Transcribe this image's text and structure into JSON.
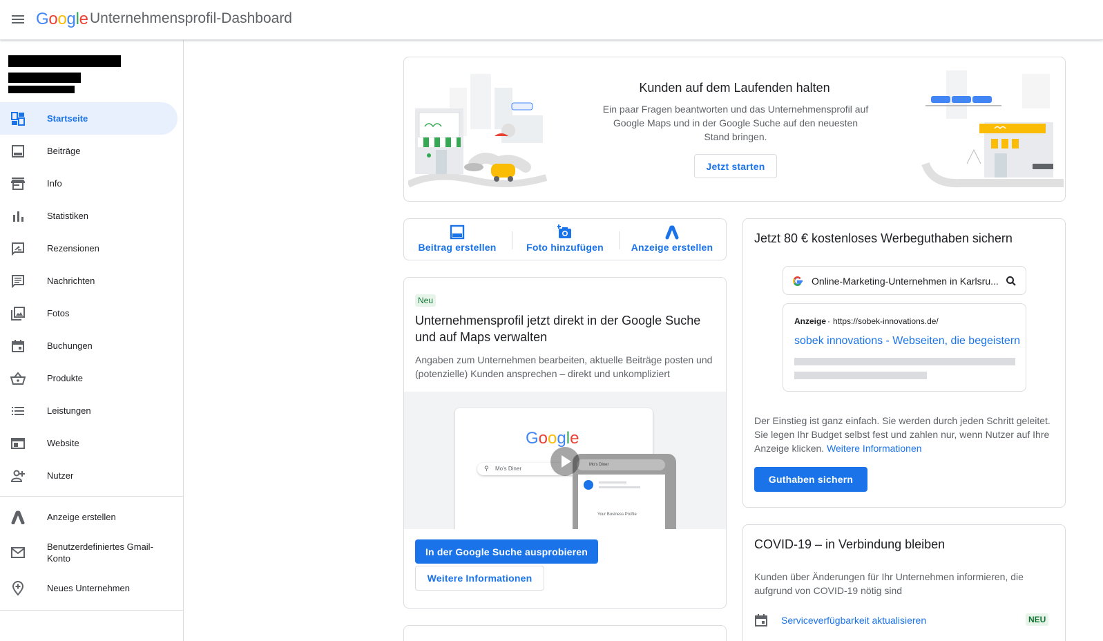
{
  "header": {
    "menu_icon": "menu-icon",
    "logo": "Google",
    "title": "Unternehmensprofil-Dashboard"
  },
  "sidebar": {
    "items": [
      {
        "label": "Startseite",
        "icon": "dashboard-icon"
      },
      {
        "label": "Beiträge",
        "icon": "posts-icon"
      },
      {
        "label": "Info",
        "icon": "storefront-icon"
      },
      {
        "label": "Statistiken",
        "icon": "bar-chart-icon"
      },
      {
        "label": "Rezensionen",
        "icon": "rate-review-icon"
      },
      {
        "label": "Nachrichten",
        "icon": "message-icon"
      },
      {
        "label": "Fotos",
        "icon": "photo-library-icon"
      },
      {
        "label": "Buchungen",
        "icon": "calendar-icon"
      },
      {
        "label": "Produkte",
        "icon": "basket-icon"
      },
      {
        "label": "Leistungen",
        "icon": "list-icon"
      },
      {
        "label": "Website",
        "icon": "web-icon"
      },
      {
        "label": "Nutzer",
        "icon": "person-add-icon"
      }
    ],
    "secondary": [
      {
        "label": "Anzeige erstellen",
        "icon": "google-ads-icon"
      },
      {
        "label": "Benutzerdefiniertes Gmail-Konto",
        "icon": "mail-icon"
      },
      {
        "label": "Neues Unternehmen",
        "icon": "add-location-icon"
      }
    ]
  },
  "hero": {
    "title": "Kunden auf dem Laufenden halten",
    "text": "Ein paar Fragen beantworten und das Unternehmensprofil auf Google Maps und in der Google Suche auf den neuesten Stand bringen.",
    "button": "Jetzt starten"
  },
  "actions": [
    {
      "label": "Beitrag erstellen",
      "icon": "post-add-icon"
    },
    {
      "label": "Foto hinzufügen",
      "icon": "add-photo-icon"
    },
    {
      "label": "Anzeige erstellen",
      "icon": "google-ads-icon"
    }
  ],
  "manage_card": {
    "badge": "Neu",
    "title": "Unternehmensprofil jetzt direkt in der Google Suche und auf Maps verwalten",
    "text": "Angaben zum Unternehmen bearbeiten, aktuelle Beiträge posten und (potenzielle) Kunden ansprechen – direkt und unkompliziert",
    "illustration": {
      "google": "Google",
      "search_text": "Mo's Diner",
      "phone_search": "Mo's Diner",
      "phone_item": "Your Business Profile"
    },
    "primary_button": "In der Google Suche ausprobieren",
    "secondary_button": "Weitere Informationen"
  },
  "ads_card": {
    "title": "Jetzt 80 € kostenloses Werbeguthaben sichern",
    "search_query": "Online-Marketing-Unternehmen in Karlsru...",
    "ad_label": "Anzeige",
    "ad_url": "https://sobek-innovations.de/",
    "ad_title": "sobek innovations - Webseiten, die begeistern",
    "text": "Der Einstieg ist ganz einfach. Sie werden durch jeden Schritt geleitet. Sie legen Ihr Budget selbst fest und zahlen nur, wenn Nutzer auf Ihre Anzeige klicken.",
    "link": "Weitere Informationen",
    "button": "Guthaben sichern"
  },
  "covid_card": {
    "title": "COVID-19 – in Verbindung bleiben",
    "text": "Kunden über Änderungen für Ihr Unternehmen informieren, die aufgrund von COVID-19 nötig sind",
    "item_label": "Serviceverfügbarkeit aktualisieren",
    "item_badge": "NEU"
  },
  "colors": {
    "primary": "#1a73e8",
    "active_bg": "#e8f0fe",
    "badge_bg": "#e6f4ea",
    "badge_text": "#137333"
  }
}
